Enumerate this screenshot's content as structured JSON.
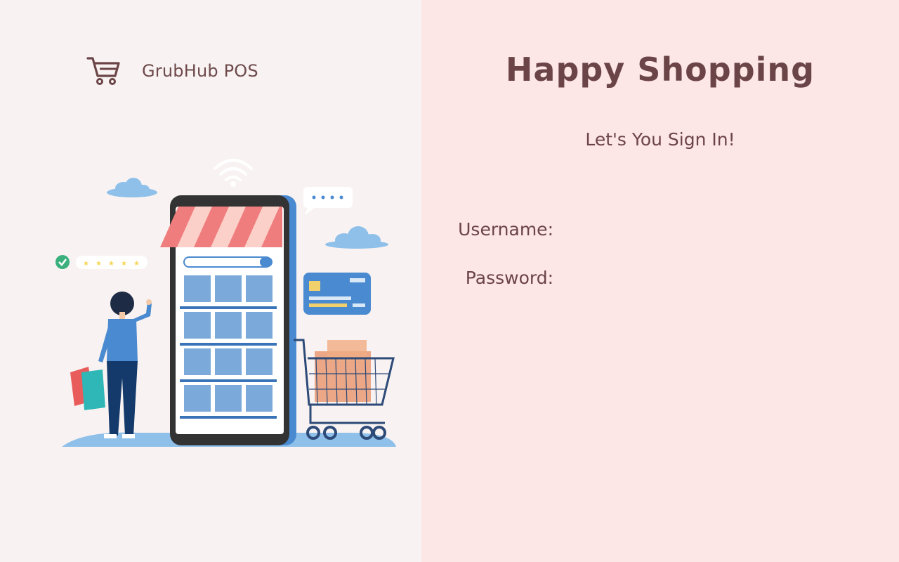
{
  "brand": {
    "icon": "shopping-cart-icon",
    "name": "GrubHub POS"
  },
  "illustration": {
    "icon": "online-shopping-illustration",
    "rating_stars": 5
  },
  "login": {
    "title": "Happy Shopping",
    "subtitle": "Let's You Sign In!",
    "username_label": "Username:",
    "username_value": "",
    "password_label": "Password:",
    "password_value": ""
  },
  "colors": {
    "left_background": "#f8f3f2",
    "right_background": "#fde6e6",
    "text_primary": "#6b4447",
    "accent_blue": "#4a8ad0"
  }
}
